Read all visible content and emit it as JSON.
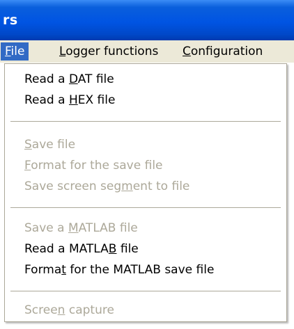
{
  "window": {
    "title": "rs"
  },
  "menubar": {
    "items": [
      {
        "pre": "",
        "key": "F",
        "post": "ile"
      },
      {
        "pre": "",
        "key": "L",
        "post": "ogger functions"
      },
      {
        "pre": "",
        "key": "C",
        "post": "onfiguration"
      }
    ],
    "active_index": 0
  },
  "file_menu": {
    "items": [
      {
        "pre": "Read a ",
        "key": "D",
        "post": "AT file",
        "enabled": true
      },
      {
        "pre": "Read a ",
        "key": "H",
        "post": "EX file",
        "enabled": true
      },
      {
        "pre": "",
        "key": "S",
        "post": "ave file",
        "enabled": false
      },
      {
        "pre": "",
        "key": "F",
        "post": "ormat for the save file",
        "enabled": false
      },
      {
        "pre": "Save screen seg",
        "key": "m",
        "post": "ent to file",
        "enabled": false
      },
      {
        "pre": "Save a ",
        "key": "M",
        "post": "ATLAB file",
        "enabled": false
      },
      {
        "pre": "Read a MATLA",
        "key": "B",
        "post": " file",
        "enabled": true
      },
      {
        "pre": "Forma",
        "key": "t",
        "post": " for the MATLAB save file",
        "enabled": true
      },
      {
        "pre": "Scree",
        "key": "n",
        "post": " capture",
        "enabled": false
      }
    ]
  },
  "colors": {
    "titlebar": "#0054e3",
    "menubar_bg": "#ece9d8",
    "highlight": "#316ac5",
    "disabled_text": "#aca899",
    "menu_border": "#aca899"
  }
}
